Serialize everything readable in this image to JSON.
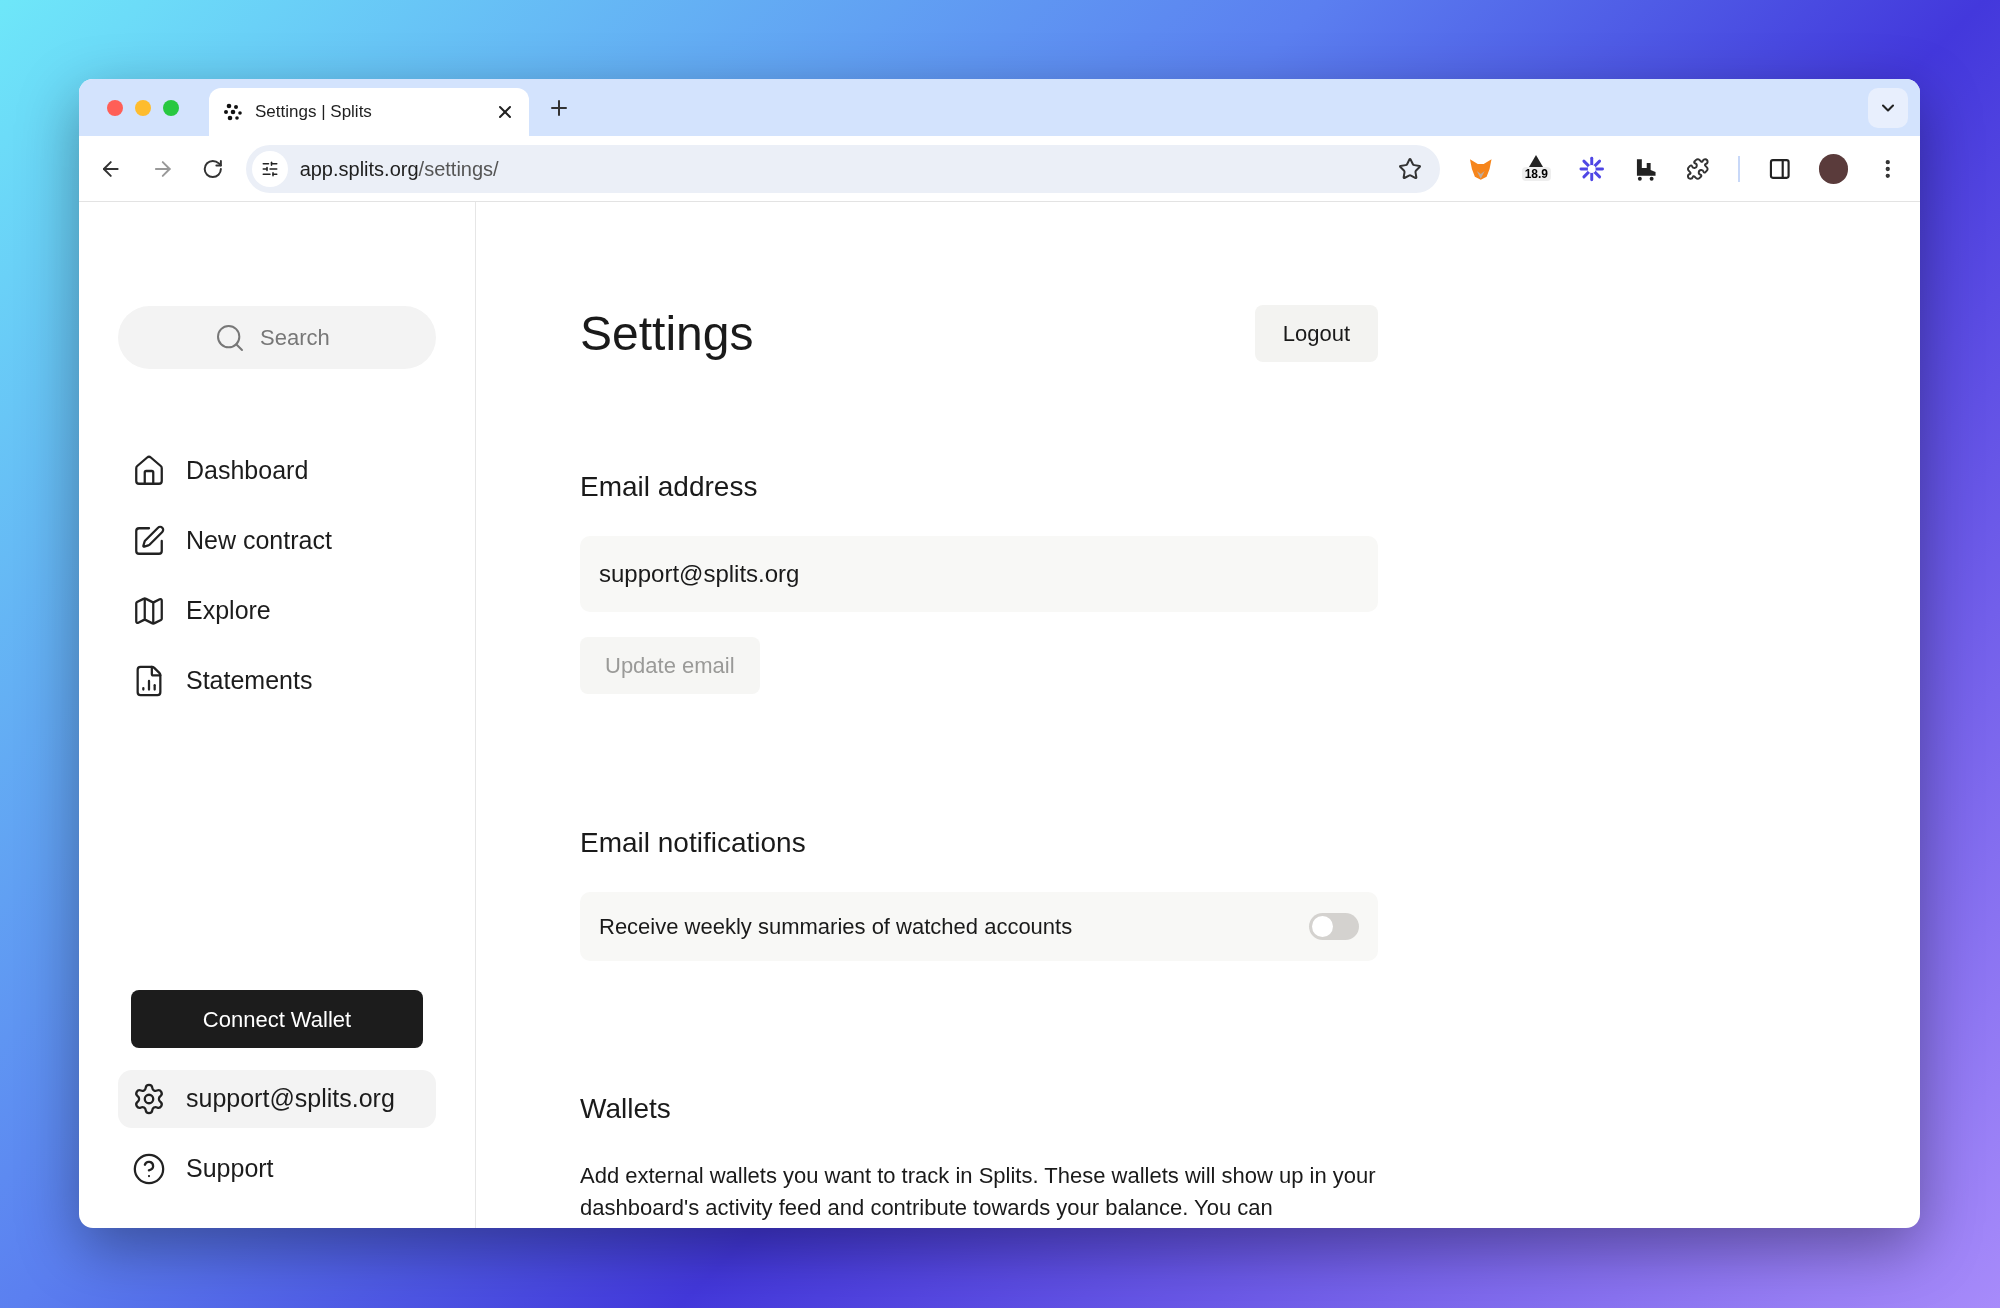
{
  "browser": {
    "tab_title": "Settings | Splits",
    "url_host": "app.splits.org",
    "url_path": "/settings/",
    "extension_badge": "18.9"
  },
  "sidebar": {
    "search": {
      "placeholder": "Search"
    },
    "nav_items": [
      {
        "label": "Dashboard",
        "kind": "home"
      },
      {
        "label": "New contract",
        "kind": "edit"
      },
      {
        "label": "Explore",
        "kind": "map"
      },
      {
        "label": "Statements",
        "kind": "file"
      }
    ],
    "connect_button": "Connect Wallet",
    "bottom_items": [
      {
        "label": "support@splits.org",
        "kind": "gear",
        "selected": true
      },
      {
        "label": "Support",
        "kind": "help",
        "selected": false
      }
    ]
  },
  "main": {
    "title": "Settings",
    "logout_button": "Logout",
    "email_section": {
      "heading": "Email address",
      "value": "support@splits.org",
      "update_button": {
        "label": "Update email",
        "disabled": true
      }
    },
    "notifications_section": {
      "heading": "Email notifications",
      "toggle": {
        "label": "Receive weekly summaries of watched accounts",
        "on": false
      }
    },
    "wallets_section": {
      "heading": "Wallets",
      "description": "Add external wallets you want to track in Splits. These wallets will show up in your dashboard's activity feed and contribute towards your balance. You can"
    }
  }
}
